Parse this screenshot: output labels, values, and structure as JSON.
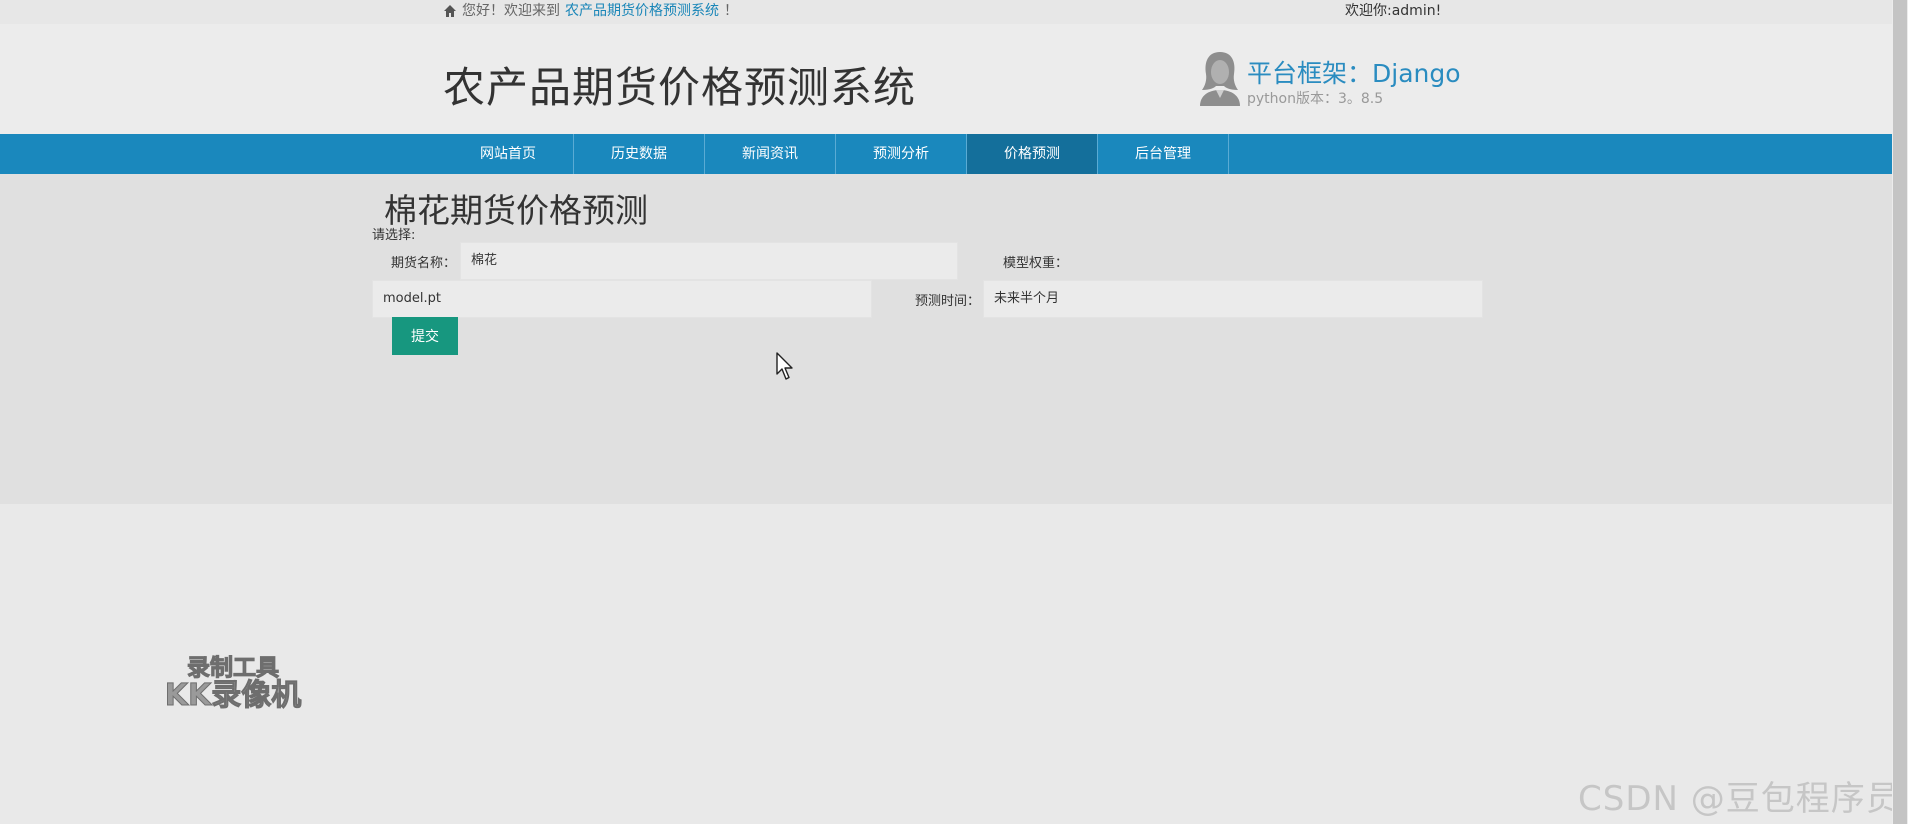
{
  "topbar": {
    "greeting": "您好！欢迎来到",
    "site_link": "农产品期货价格预测系统",
    "greeting_end": "！",
    "user_text": "欢迎你:admin!"
  },
  "header": {
    "title": "农产品期货价格预测系统",
    "framework": "平台框架：Django",
    "python_version": "python版本：3。8.5"
  },
  "nav": {
    "items": [
      {
        "label": "网站首页"
      },
      {
        "label": "历史数据"
      },
      {
        "label": "新闻资讯"
      },
      {
        "label": "预测分析"
      },
      {
        "label": "价格预测"
      },
      {
        "label": "后台管理"
      }
    ],
    "active": "价格预测"
  },
  "main": {
    "heading": "棉花期货价格预测",
    "choose_label": "请选择:",
    "future_name_label": "期货名称：",
    "future_name_value": "棉花",
    "model_weight_label": "模型权重：",
    "model_weight_value": "model.pt",
    "predict_time_label": "预测时间：",
    "predict_time_value": "未来半个月",
    "submit_label": "提交"
  },
  "watermarks": {
    "recorder_line1": "录制工具",
    "recorder_line2": "KK录像机",
    "csdn": "CSDN @豆包程序员"
  },
  "colors": {
    "nav_bg": "#1a88bd",
    "nav_active_bg": "#146f9b",
    "button_bg": "#17977f",
    "link": "#1a86b8"
  }
}
